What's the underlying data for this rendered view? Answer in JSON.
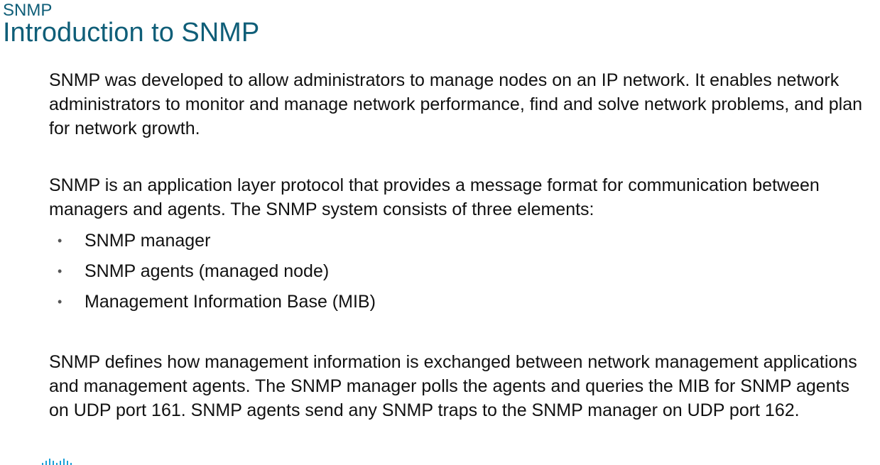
{
  "header": {
    "section_label": "SNMP",
    "title": "Introduction to SNMP"
  },
  "body": {
    "paragraph_1": "SNMP was developed to allow administrators to manage nodes on an IP network. It enables network administrators to monitor and manage network performance, find and solve network problems, and plan for network growth.",
    "paragraph_2": "SNMP is an application layer protocol that provides a message format for communication between managers and agents. The SNMP system consists of three elements:",
    "bullets": [
      "SNMP manager",
      "SNMP agents (managed node)",
      "Management Information Base (MIB)"
    ],
    "bullet_symbol": "•",
    "paragraph_3": "SNMP defines how management information is exchanged between network management applications and management agents. The SNMP manager polls the agents and queries the MIB for SNMP agents on UDP port 161. SNMP agents send any SNMP traps to the SNMP manager on UDP port 162."
  },
  "colors": {
    "title": "#0f5e78",
    "text": "#111111",
    "logo": "#1ba0d7"
  },
  "icons": {
    "footer_logo": "cisco-logo-icon"
  }
}
